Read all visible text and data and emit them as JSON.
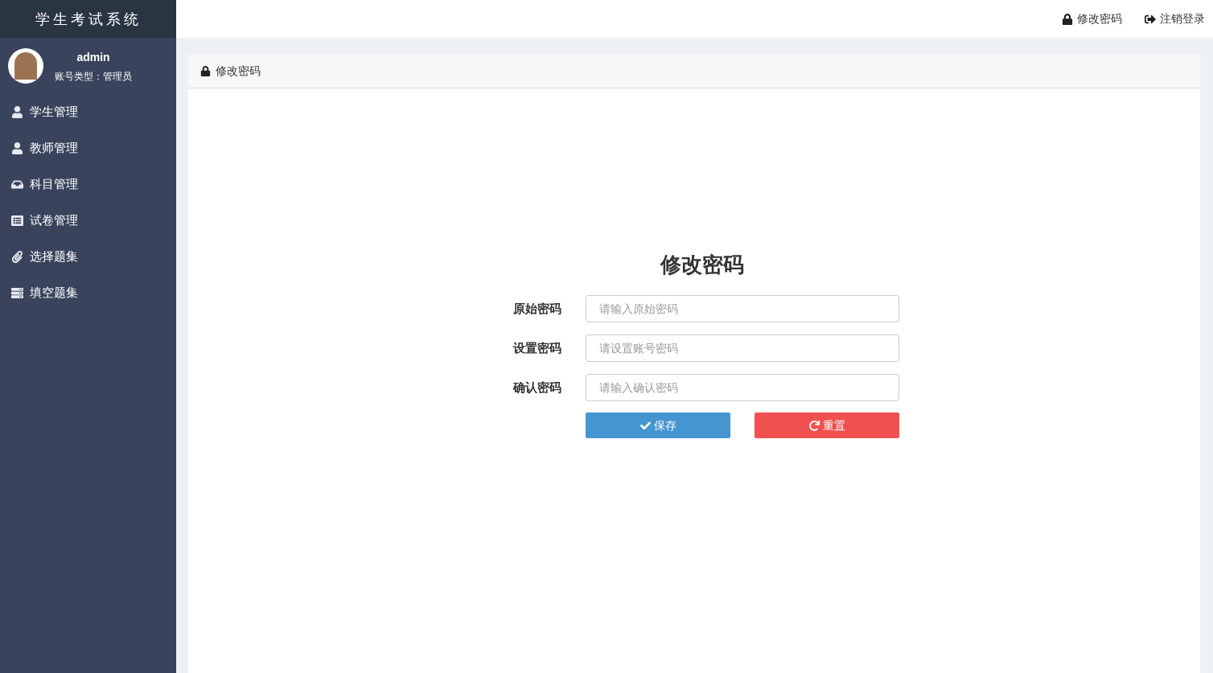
{
  "app_title": "学生考试系统",
  "user": {
    "name": "admin",
    "role": "账号类型：管理员"
  },
  "sidebar": {
    "items": [
      {
        "label": "学生管理"
      },
      {
        "label": "教师管理"
      },
      {
        "label": "科目管理"
      },
      {
        "label": "试卷管理"
      },
      {
        "label": "选择题集"
      },
      {
        "label": "填空题集"
      }
    ]
  },
  "header_links": [
    {
      "label": "修改密码"
    },
    {
      "label": "注销登录"
    }
  ],
  "panel": {
    "title": "修改密码"
  },
  "form": {
    "title": "修改密码",
    "fields": [
      {
        "label": "原始密码",
        "placeholder": "请输入原始密码"
      },
      {
        "label": "设置密码",
        "placeholder": "请设置账号密码"
      },
      {
        "label": "确认密码",
        "placeholder": "请输入确认密码"
      }
    ],
    "buttons": [
      {
        "kind": "save",
        "label": "保存"
      },
      {
        "kind": "reset",
        "label": "重置"
      }
    ]
  }
}
